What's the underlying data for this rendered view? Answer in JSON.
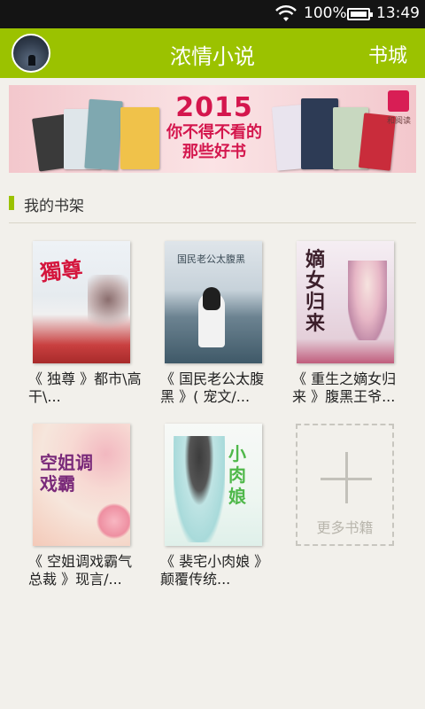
{
  "status_bar": {
    "battery_text": "100%",
    "time": "13:49",
    "icons": [
      "wifi-icon",
      "battery-icon"
    ]
  },
  "header": {
    "title": "浓情小说",
    "store_label": "书城",
    "accent_color": "#9bc200"
  },
  "banner": {
    "year": "2015",
    "line1": "你不得不看的",
    "line2": "那些好书",
    "brand_label": "和阅读",
    "accent_color": "#d4164d"
  },
  "shelf": {
    "title": "我的书架",
    "books": [
      {
        "title": "《 独尊 》都市\\高干\\...",
        "cover_text": "獨尊"
      },
      {
        "title": "《 国民老公太腹黑 》( 宠文/...",
        "cover_text": "国民老公太腹黑"
      },
      {
        "title": "《 重生之嫡女归来 》腹黑王爷...",
        "cover_text": "嫡女归来"
      },
      {
        "title": "《 空姐调戏霸气总裁 》现言/...",
        "cover_text": "空姐调戏霸"
      },
      {
        "title": "《 裴宅小肉娘 》颠覆传统...",
        "cover_text": "小肉娘"
      }
    ],
    "more_label": "更多书籍"
  }
}
